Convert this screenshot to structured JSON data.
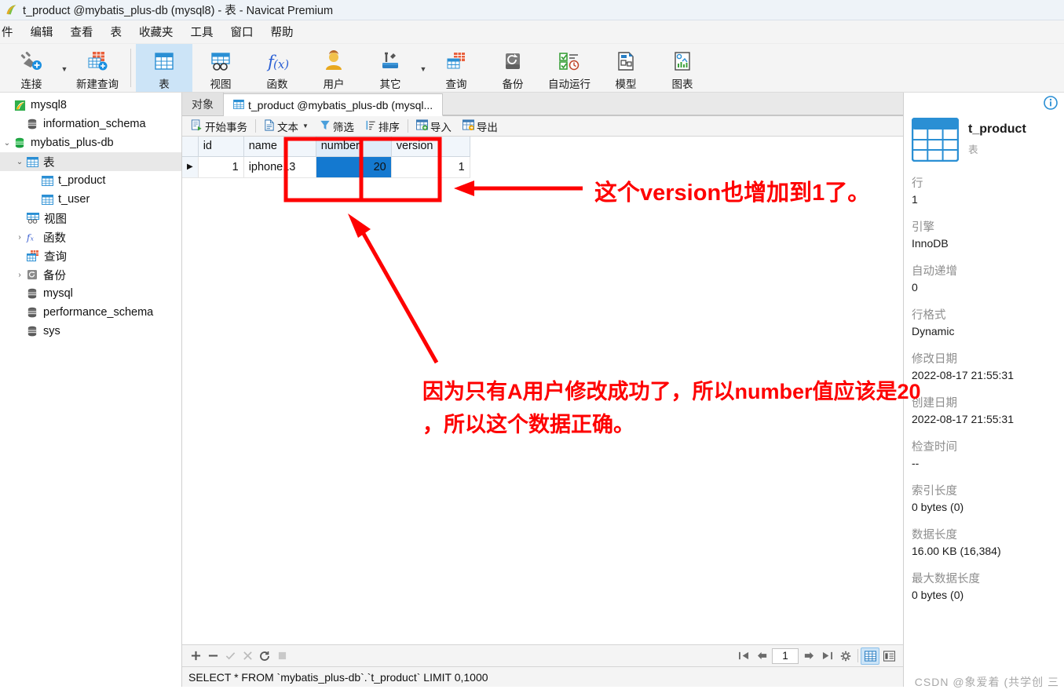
{
  "window": {
    "title": "t_product @mybatis_plus-db (mysql8) - 表 - Navicat Premium",
    "app_icon": "navicat-logo-icon"
  },
  "menubar": {
    "items": [
      "件",
      "编辑",
      "查看",
      "表",
      "收藏夹",
      "工具",
      "窗口",
      "帮助"
    ]
  },
  "toolbar": {
    "buttons": [
      {
        "label": "连接",
        "icon": "connection-icon",
        "active": false,
        "caret": true
      },
      {
        "label": "新建查询",
        "icon": "new-query-icon",
        "active": false,
        "caret": false
      },
      {
        "label": "表",
        "icon": "table-icon",
        "active": true,
        "caret": false
      },
      {
        "label": "视图",
        "icon": "view-icon",
        "active": false,
        "caret": false
      },
      {
        "label": "函数",
        "icon": "function-icon",
        "active": false,
        "caret": false
      },
      {
        "label": "用户",
        "icon": "user-icon",
        "active": false,
        "caret": false
      },
      {
        "label": "其它",
        "icon": "others-icon",
        "active": false,
        "caret": true
      },
      {
        "label": "查询",
        "icon": "query-icon",
        "active": false,
        "caret": false
      },
      {
        "label": "备份",
        "icon": "backup-icon",
        "active": false,
        "caret": false
      },
      {
        "label": "自动运行",
        "icon": "automation-icon",
        "active": false,
        "caret": false
      },
      {
        "label": "模型",
        "icon": "model-icon",
        "active": false,
        "caret": false
      },
      {
        "label": "图表",
        "icon": "chart-icon",
        "active": false,
        "caret": false
      }
    ]
  },
  "sidebar": {
    "items": [
      {
        "label": "mysql8",
        "indent": 0,
        "icon": "navicat-conn-icon",
        "twisty": "",
        "selected": false
      },
      {
        "label": "information_schema",
        "indent": 1,
        "icon": "database-icon",
        "twisty": "",
        "selected": false
      },
      {
        "label": "mybatis_plus-db",
        "indent": 1,
        "icon": "database-open-icon",
        "twisty": "v",
        "selected": false
      },
      {
        "label": "表",
        "indent": 2,
        "icon": "table-folder-icon",
        "twisty": "v",
        "selected": true
      },
      {
        "label": "t_product",
        "indent": 3,
        "icon": "table-icon",
        "twisty": "",
        "selected": false
      },
      {
        "label": "t_user",
        "indent": 3,
        "icon": "table-icon",
        "twisty": "",
        "selected": false
      },
      {
        "label": "视图",
        "indent": 2,
        "icon": "view-folder-icon",
        "twisty": "",
        "selected": false
      },
      {
        "label": "函数",
        "indent": 2,
        "icon": "function-folder-icon",
        "twisty": ">",
        "selected": false
      },
      {
        "label": "查询",
        "indent": 2,
        "icon": "query-folder-icon",
        "twisty": "",
        "selected": false
      },
      {
        "label": "备份",
        "indent": 2,
        "icon": "backup-folder-icon",
        "twisty": ">",
        "selected": false
      },
      {
        "label": "mysql",
        "indent": 1,
        "icon": "database-icon",
        "twisty": "",
        "selected": false
      },
      {
        "label": "performance_schema",
        "indent": 1,
        "icon": "database-icon",
        "twisty": "",
        "selected": false
      },
      {
        "label": "sys",
        "indent": 1,
        "icon": "database-icon",
        "twisty": "",
        "selected": false
      }
    ]
  },
  "tabs": [
    {
      "label": "对象",
      "icon": "",
      "active": false
    },
    {
      "label": "t_product @mybatis_plus-db (mysql...",
      "icon": "table-icon",
      "active": true
    }
  ],
  "grid_toolbar": {
    "buttons": [
      {
        "label": "开始事务",
        "icon": "begin-transaction-icon",
        "caret": false
      },
      {
        "label": "文本",
        "icon": "text-icon",
        "caret": true
      },
      {
        "label": "筛选",
        "icon": "filter-icon",
        "caret": false
      },
      {
        "label": "排序",
        "icon": "sort-icon",
        "caret": false
      },
      {
        "label": "导入",
        "icon": "import-icon",
        "caret": false
      },
      {
        "label": "导出",
        "icon": "export-icon",
        "caret": false
      }
    ]
  },
  "grid": {
    "columns": [
      "id",
      "name",
      "number",
      "version"
    ],
    "selected_column": "number",
    "rows": [
      {
        "marker": "▶",
        "id": "1",
        "name": "iphone13",
        "number": "20",
        "version": "1"
      }
    ],
    "selected_cell": {
      "row": 0,
      "column": "number"
    }
  },
  "bottom_bar": {
    "edit_icons": [
      "add-record-icon",
      "delete-record-icon",
      "apply-change-icon",
      "cancel-change-icon",
      "refresh-icon",
      "stop-icon"
    ],
    "nav": {
      "first_icon": "first-page-icon",
      "prev_icon": "prev-page-icon",
      "page_value": "1",
      "next_icon": "next-page-icon",
      "last_icon": "last-page-icon",
      "settings_icon": "gear-icon"
    },
    "view_toggles": [
      {
        "icon": "grid-view-icon",
        "active": true
      },
      {
        "icon": "form-view-icon",
        "active": false
      }
    ]
  },
  "status_bar": {
    "sql": "SELECT * FROM `mybatis_plus-db`.`t_product` LIMIT 0,1000"
  },
  "info_panel": {
    "info_icon": "info-circle-icon",
    "table_icon": "table-large-icon",
    "name": "t_product",
    "subtitle": "表",
    "fields": [
      {
        "key": "行",
        "value": "1"
      },
      {
        "key": "引擎",
        "value": "InnoDB"
      },
      {
        "key": "自动递增",
        "value": "0"
      },
      {
        "key": "行格式",
        "value": "Dynamic"
      },
      {
        "key": "修改日期",
        "value": "2022-08-17 21:55:31"
      },
      {
        "key": "创建日期",
        "value": "2022-08-17 21:55:31"
      },
      {
        "key": "检查时间",
        "value": "--"
      },
      {
        "key": "索引长度",
        "value": "0 bytes (0)"
      },
      {
        "key": "数据长度",
        "value": "16.00 KB (16,384)"
      },
      {
        "key": "最大数据长度",
        "value": "0 bytes (0)"
      }
    ]
  },
  "annotations": {
    "color": "#fe0000",
    "note_version": "这个version也增加到1了。",
    "note_number_line1": "因为只有A用户修改成功了，所以number值应该是20",
    "note_number_line2": "，所以这个数据正确。"
  },
  "watermark": {
    "text": "CSDN @象爱着 (共学创 三"
  }
}
